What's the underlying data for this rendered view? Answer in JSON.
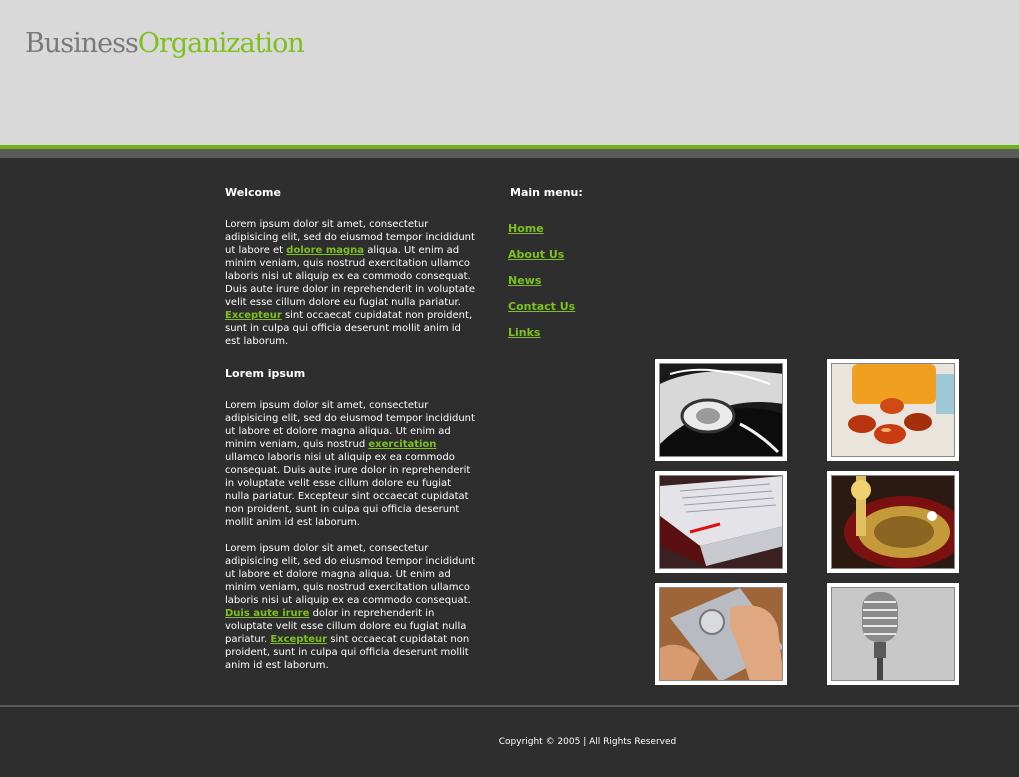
{
  "logo": {
    "part1": "Business",
    "part2": "Organization"
  },
  "welcome": {
    "title": "Welcome",
    "p1_a": "Lorem ipsum dolor sit amet, consectetur adipisicing elit, sed do eiusmod tempor incididunt ut labore et ",
    "p1_link1": "dolore magna",
    "p1_b": " aliqua. Ut enim ad minim veniam, quis nostrud exercitation ullamco laboris nisi ut aliquip ex ea commodo consequat. Duis aute irure dolor in reprehenderit in voluptate velit esse cillum dolore eu fugiat nulla pariatur. ",
    "p1_link2": "Excepteur",
    "p1_c": " sint occaecat cupidatat non proident, sunt in culpa qui officia deserunt mollit anim id est laborum."
  },
  "lorem": {
    "title": "Lorem ipsum",
    "p2_a": "Lorem ipsum dolor sit amet, consectetur adipisicing elit, sed do eiusmod tempor incididunt ut labore et dolore magna aliqua. Ut enim ad minim veniam, quis nostrud ",
    "p2_link": "exercitation",
    "p2_b": " ullamco laboris nisi ut aliquip ex ea commodo consequat. Duis aute irure dolor in reprehenderit in voluptate velit esse cillum dolore eu fugiat nulla pariatur. Excepteur sint occaecat cupidatat non proident, sunt in culpa qui officia deserunt mollit anim id est laborum.",
    "p3_a": "Lorem ipsum dolor sit amet, consectetur adipisicing elit, sed do eiusmod tempor incididunt ut labore et dolore magna aliqua. Ut enim ad minim veniam, quis nostrud exercitation ullamco laboris nisi ut aliquip ex ea commodo consequat. ",
    "p3_link1": "Duis aute irure",
    "p3_b": " dolor in reprehenderit in voluptate velit esse cillum dolore eu fugiat nulla pariatur. ",
    "p3_link2": "Excepteur",
    "p3_c": " sint occaecat cupidatat non proident, sunt in culpa qui officia deserunt mollit anim id est laborum."
  },
  "menu": {
    "title": "Main menu:",
    "items": [
      {
        "label": "Home"
      },
      {
        "label": "About Us"
      },
      {
        "label": "News"
      },
      {
        "label": "Contact Us"
      },
      {
        "label": "Links"
      }
    ]
  },
  "gallery": [
    "car-photo",
    "pills-photo",
    "book-photo",
    "roulette-photo",
    "phone-photo",
    "microphone-photo"
  ],
  "footer": {
    "copyright": "Copyright © 2005 | All Rights Reserved"
  },
  "colors": {
    "accent": "#7ec01f",
    "background": "#2e2e2e",
    "header": "#d9d9d9",
    "logo_gray": "#7a7a7a"
  }
}
